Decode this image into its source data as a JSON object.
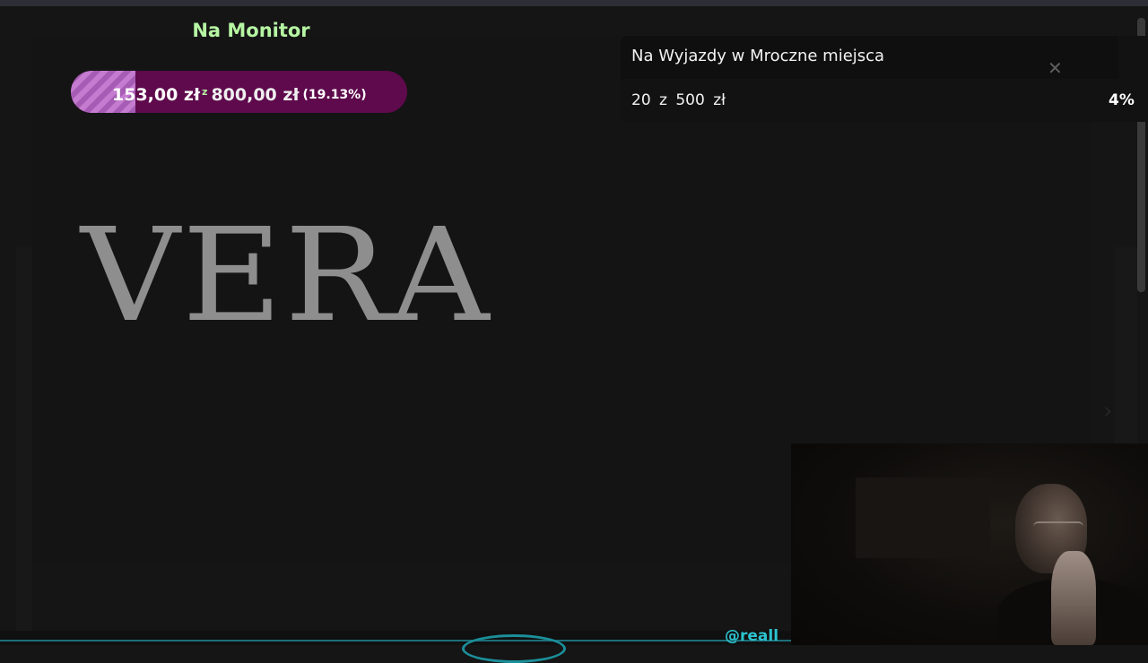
{
  "donation_goal": {
    "title": "Na Monitor",
    "current": "153,00 zł",
    "separator": "z",
    "target": "800,00 zł",
    "percent_label": "(19.13%)",
    "progress_fraction": 0.1913,
    "colors": {
      "bar_bg": "#5e0a4c",
      "bar_fill": "#c47bd0",
      "title": "#b6f5a3"
    }
  },
  "overlay_logo": {
    "text": "VERA"
  },
  "tip_goal": {
    "title": "Na Wyjazdy w Mroczne miejsca",
    "progress_text": "20  z  500  zł",
    "percent": "4%",
    "progress_fraction": 0.04,
    "close_icon": "close-icon"
  },
  "footer": {
    "handle_fragment": "@reall"
  }
}
